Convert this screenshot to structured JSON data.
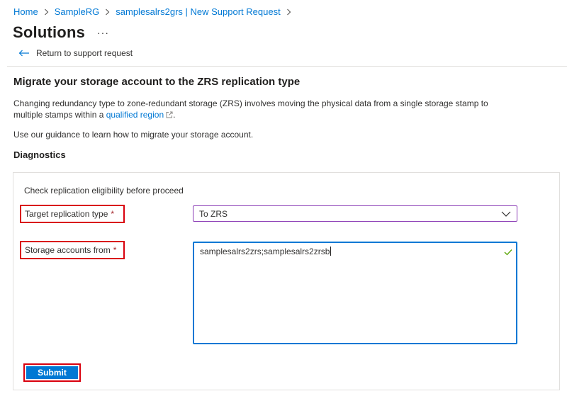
{
  "breadcrumb": {
    "items": [
      {
        "label": "Home"
      },
      {
        "label": "SampleRG"
      },
      {
        "label": "samplesalrs2grs | New Support Request"
      }
    ]
  },
  "header": {
    "title": "Solutions",
    "more_label": "···"
  },
  "return_link": {
    "label": "Return to support request"
  },
  "solution": {
    "heading": "Migrate your storage account to the ZRS replication type",
    "description_before_link": "Changing redundancy type to zone-redundant storage (ZRS) involves moving the physical data from a single storage stamp to multiple stamps within a ",
    "description_link": "qualified region",
    "guidance": "Use our guidance to learn how to migrate your storage account."
  },
  "diagnostics": {
    "heading": "Diagnostics",
    "check_label": "Check replication eligibility before proceed",
    "target_label": "Target replication type",
    "target_value": "To ZRS",
    "storage_label": "Storage accounts from",
    "storage_value": "samplesalrs2zrs;samplesalrs2zrsb",
    "required_marker": "*",
    "submit_label": "Submit"
  },
  "icons": {
    "back": "arrow-left-icon",
    "chevron": "chevron-right-icon",
    "external": "external-link-icon",
    "dropdown": "chevron-down-icon",
    "valid": "checkmark-icon"
  },
  "colors": {
    "link": "#0078d4",
    "primary_button": "#0078d4",
    "highlight_border": "#d9000d",
    "valid_check": "#57a300"
  }
}
